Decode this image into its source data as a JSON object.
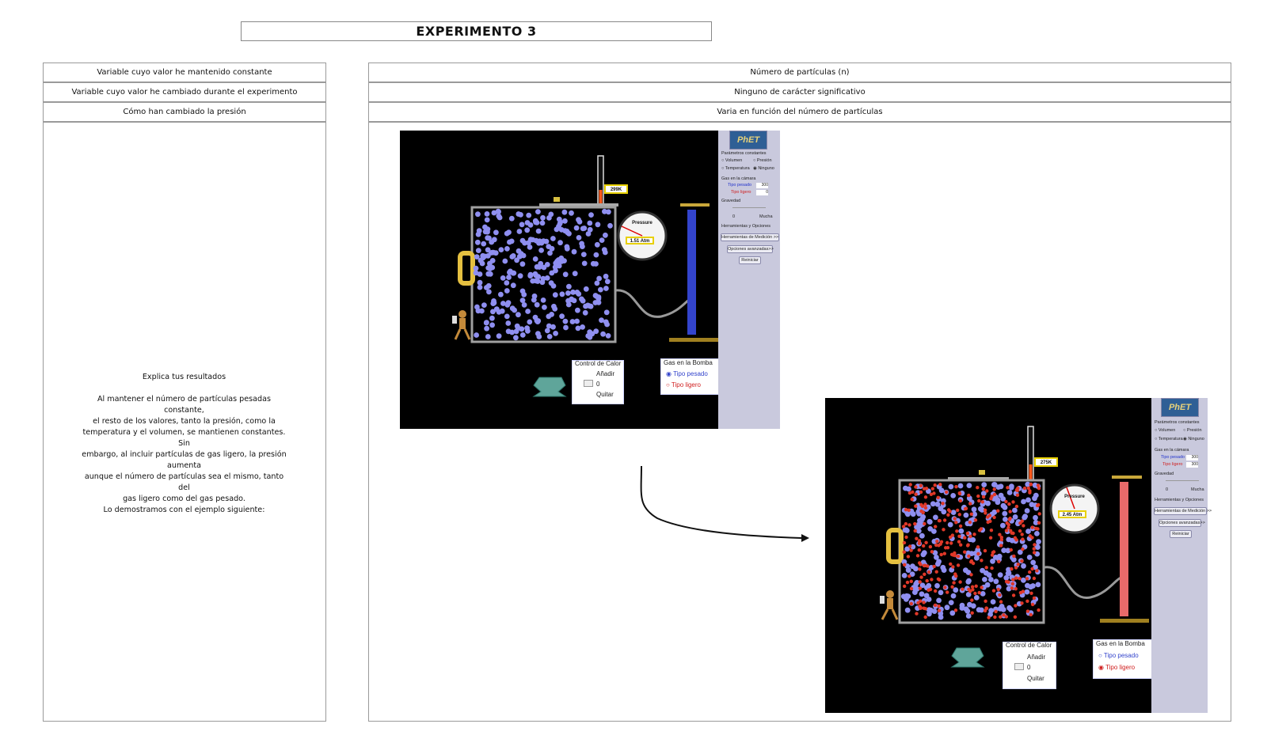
{
  "title": "EXPERIMENTO 3",
  "rows": [
    {
      "label": "Variable cuyo valor he mantenido constante",
      "value": "Número de partículas (n)"
    },
    {
      "label": "Variable cuyo valor he cambiado durante el experimento",
      "value": "Ninguno de carácter significativo"
    },
    {
      "label": "Cómo han cambiado la presión",
      "value": "Varia en función del número de partículas"
    }
  ],
  "explain": {
    "heading": "Explica tus resultados",
    "lines": [
      "Al mantener el número de partículas pesadas constante,",
      "el resto de los valores, tanto la presión, como la",
      "temperatura y el volumen, se mantienen constantes. Sin",
      "embargo, al incluir partículas de gas ligero, la presión aumenta",
      "aunque el número de partículas sea el mismo, tanto del",
      "gas ligero como del gas pesado.",
      "Lo demostramos con el ejemplo siguiente:"
    ]
  },
  "sim_common": {
    "logo": "PhET",
    "params_label": "Parámetros constantes",
    "opt_volumen": "Volumen",
    "opt_presion": "Presión",
    "opt_temperatura": "Temperatura",
    "opt_ninguno": "Ninguno",
    "gas_chamber": "Gas en la cámara",
    "heavy_label": "Tipo pesado",
    "light_label": "Tipo ligero",
    "gravity": "Gravedad",
    "gravity_min": "0",
    "gravity_max": "Mucha",
    "tools": "Herramientas y Opciones",
    "btn_measure": "Herramientas de Medición >>",
    "btn_advanced": "Opciones avanzadas>>",
    "btn_reset": "Reiniciar",
    "gauge_word": "Pressure",
    "heat_title": "Control de Calor",
    "heat_add": "Añadir",
    "heat_zero": "0",
    "heat_remove": "Quitar",
    "pump_title": "Gas en la Bomba",
    "pump_heavy": "Tipo pesado",
    "pump_light": "Tipo ligero"
  },
  "sim1": {
    "temperature": "299K",
    "pressure": "1.51 Atm",
    "heavy_count": "300",
    "light_count": "0",
    "pump_selected": "heavy"
  },
  "sim2": {
    "temperature": "275K",
    "pressure": "2.45 Atm",
    "heavy_count": "300",
    "light_count": "300",
    "pump_selected": "light"
  },
  "colors": {
    "heavy": "#8f8ff0",
    "light": "#e03828",
    "pump_heavy": "#3344cc",
    "pump_light": "#e86a6a",
    "thermo": "#ff5a1e"
  }
}
